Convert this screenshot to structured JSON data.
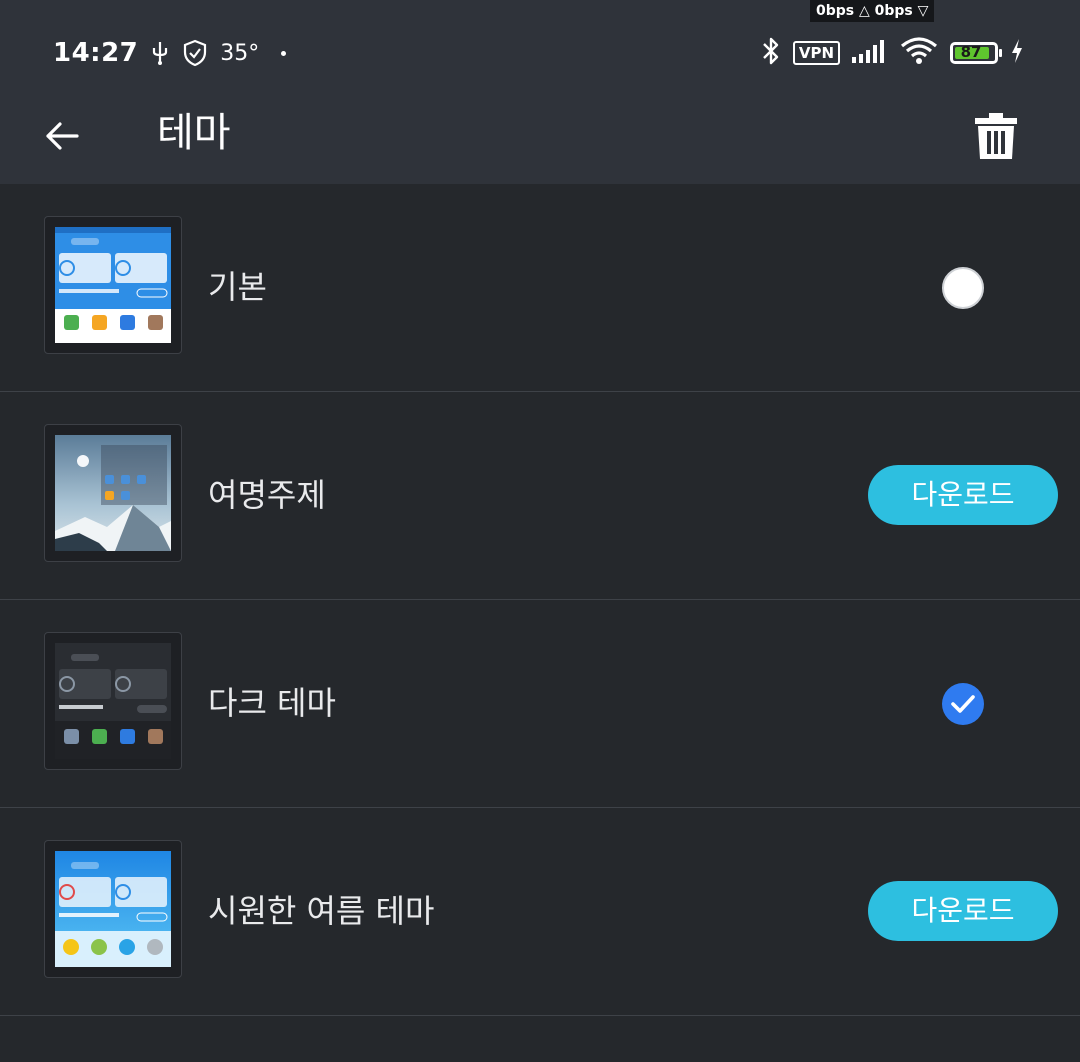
{
  "status_bar": {
    "net_speed": "0bps △  0bps ▽",
    "time": "14:27",
    "temperature": "35°",
    "vpn_label": "VPN",
    "battery_level": "87"
  },
  "app_bar": {
    "title": "테마"
  },
  "themes": [
    {
      "name": "기본",
      "state": "unselected"
    },
    {
      "name": "여명주제",
      "action_label": "다운로드"
    },
    {
      "name": "다크 테마",
      "state": "selected"
    },
    {
      "name": "시원한 여름 테마",
      "action_label": "다운로드"
    }
  ],
  "colors": {
    "background": "#25282c",
    "app_bar": "#2f333a",
    "accent_download": "#2dbfe0",
    "radio_selected": "#2f7bf0"
  }
}
